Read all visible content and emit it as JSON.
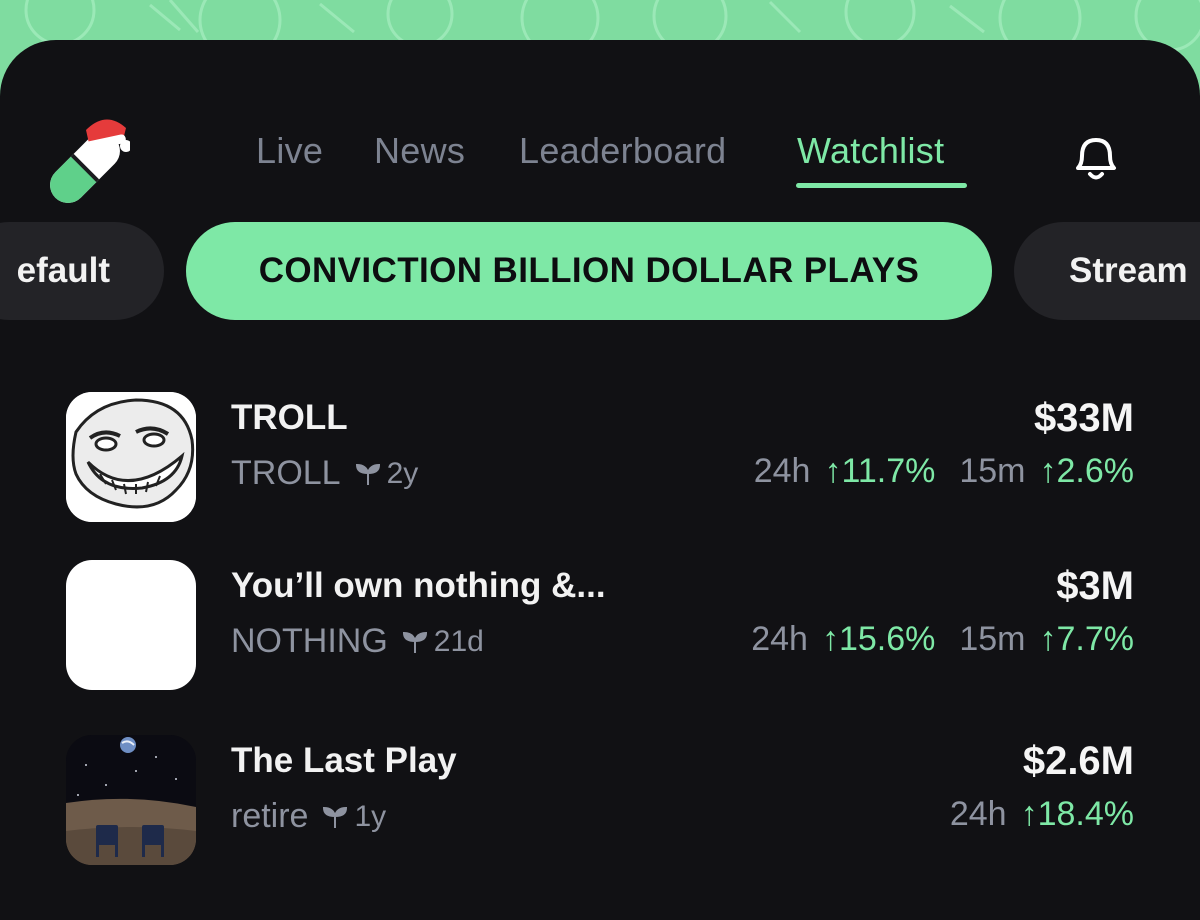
{
  "nav": {
    "tabs": [
      {
        "label": "Live"
      },
      {
        "label": "News"
      },
      {
        "label": "Leaderboard"
      },
      {
        "label": "Watchlist",
        "active": true
      }
    ],
    "bell_icon": "bell-icon",
    "logo_icon": "pill-santa-hat-logo"
  },
  "lists": {
    "chips": [
      {
        "label": "efault"
      },
      {
        "label": "CONVICTION BILLION DOLLAR PLAYS",
        "active": true
      },
      {
        "label": "Stream"
      }
    ]
  },
  "tokens": [
    {
      "name": "TROLL",
      "ticker": "TROLL",
      "age": "2y",
      "market_cap": "$33M",
      "change_24h_label": "24h",
      "change_24h": "↑11.7%",
      "change_15m_label": "15m",
      "change_15m": "↑2.6%",
      "avatar": "troll-face"
    },
    {
      "name": "You’ll own nothing &...",
      "ticker": "NOTHING",
      "age": "21d",
      "market_cap": "$3M",
      "change_24h_label": "24h",
      "change_24h": "↑15.6%",
      "change_15m_label": "15m",
      "change_15m": "↑7.7%",
      "avatar": "blank-white"
    },
    {
      "name": "The Last Play",
      "ticker": "retire",
      "age": "1y",
      "market_cap": "$2.6M",
      "change_24h_label": "24h",
      "change_24h": "↑18.4%",
      "avatar": "moon-chairs"
    }
  ],
  "colors": {
    "accent": "#7ee8a6",
    "panel": "#111114",
    "chip": "#232327",
    "muted": "#8e93a0"
  }
}
